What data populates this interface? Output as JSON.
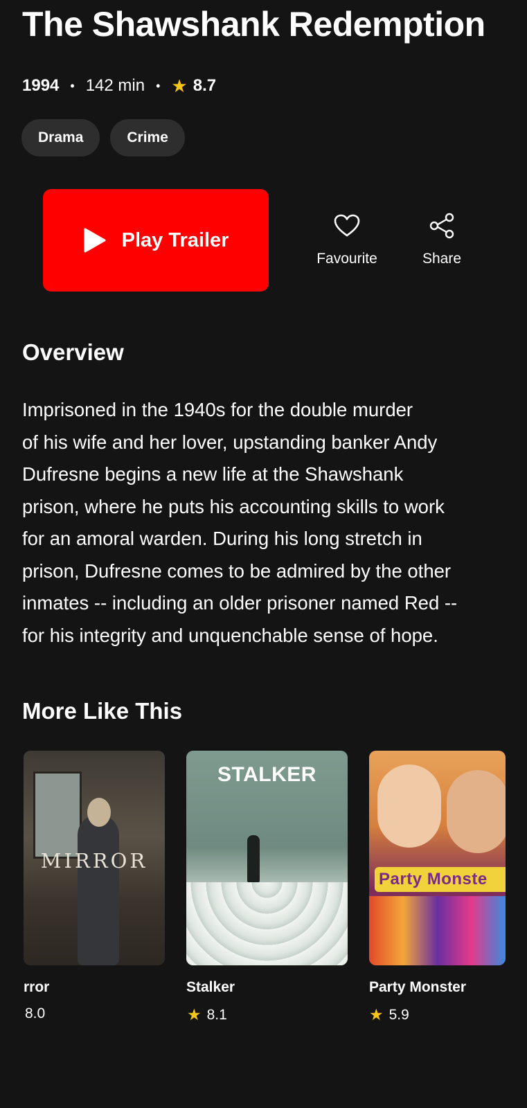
{
  "movie": {
    "title": "The Shawshank Redemption",
    "year": "1994",
    "runtime": "142 min",
    "rating": "8.7",
    "separator": "•",
    "genres": [
      "Drama",
      "Crime"
    ]
  },
  "actions": {
    "play_trailer": "Play Trailer",
    "favourite": "Favourite",
    "share": "Share"
  },
  "overview": {
    "heading": "Overview",
    "lines": [
      "Imprisoned in the 1940s for the double murder",
      "of his wife and her lover, upstanding banker Andy",
      "Dufresne begins a new life at the Shawshank",
      "prison, where he puts his accounting skills to work",
      "for an amoral warden. During his long stretch in",
      "prison, Dufresne comes to be admired by the other",
      "inmates -- including an older prisoner named Red --",
      "for his integrity and unquenchable sense of hope."
    ]
  },
  "more_like_this": {
    "heading": "More Like This",
    "items": [
      {
        "title": "rror",
        "rating": "8.0",
        "poster_text": "MIRROR"
      },
      {
        "title": "Stalker",
        "rating": "8.1",
        "poster_text": "STALKER"
      },
      {
        "title": "Party Monster",
        "rating": "5.9",
        "poster_text": "Party Monste"
      }
    ]
  },
  "colors": {
    "background": "#141414",
    "accent": "#ff0000",
    "star": "#f5c518",
    "chip": "#2e2e2e"
  },
  "icons": {
    "rating": "star-icon",
    "play": "play-icon",
    "favourite": "heart-icon",
    "share": "share-icon"
  }
}
